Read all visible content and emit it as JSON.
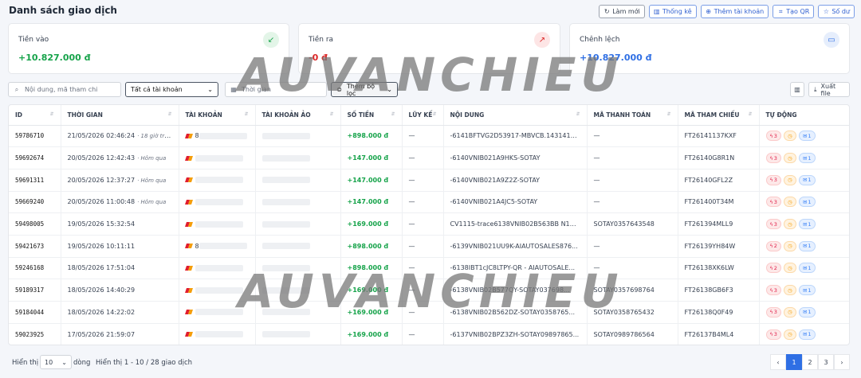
{
  "header": {
    "title": "Danh sách giao dịch",
    "actions": [
      {
        "label": "Làm mới",
        "icon": "refresh-icon",
        "glyph": "↻",
        "blue": false
      },
      {
        "label": "Thống kê",
        "icon": "chart-icon",
        "glyph": "▥",
        "blue": true
      },
      {
        "label": "Thêm tài khoản",
        "icon": "plus-circle-icon",
        "glyph": "⊕",
        "blue": true
      },
      {
        "label": "Tạo QR",
        "icon": "qr-icon",
        "glyph": "⌗",
        "blue": true
      },
      {
        "label": "Số dư",
        "icon": "star-icon",
        "glyph": "☆",
        "blue": true
      }
    ]
  },
  "summary": {
    "in": {
      "label": "Tiền vào",
      "value": "+10.827.000 đ",
      "color": "#16a34a"
    },
    "out": {
      "label": "Tiền ra",
      "value": "-0 đ",
      "color": "#dc2626"
    },
    "diff": {
      "label": "Chênh lệch",
      "value": "+10.827.000 đ",
      "color": "#2f6fe4"
    }
  },
  "filters": {
    "search_placeholder": "Nội dung, mã tham chi",
    "account_select": "Tất cả tài khoản",
    "date_placeholder": "Thời gian",
    "more_filters": "Thêm bộ lọc",
    "export": "Xuất file"
  },
  "table": {
    "columns": [
      "ID",
      "THỜI GIAN",
      "TÀI KHOẢN",
      "TÀI KHOẢN ẢO",
      "SỐ TIỀN",
      "LŨY KẾ",
      "NỘI DUNG",
      "MÃ THANH TOÁN",
      "MÃ THAM CHIẾU",
      "TỰ ĐỘNG"
    ],
    "rows": [
      {
        "id": "59786710",
        "time": "21/05/2026 02:46:24",
        "ago": "· 18 giờ trước",
        "account": "8",
        "amount": "+898.000 đ",
        "cum": "—",
        "content": "-6141BFTVG2D53917-MBVCB.14314113904.f...",
        "paycode": "—",
        "ref": "FT26141137KXF",
        "a": "3",
        "c": "1"
      },
      {
        "id": "59692674",
        "time": "20/05/2026 12:42:43",
        "ago": "· Hôm qua",
        "account": "",
        "amount": "+147.000 đ",
        "cum": "—",
        "content": "-6140VNIB021A9HKS-SOTAY",
        "paycode": "—",
        "ref": "FT26140G8R1N",
        "a": "3",
        "c": "1"
      },
      {
        "id": "59691311",
        "time": "20/05/2026 12:37:27",
        "ago": "· Hôm qua",
        "account": "",
        "amount": "+147.000 đ",
        "cum": "—",
        "content": "-6140VNIB021A9Z2Z-SOTAY",
        "paycode": "—",
        "ref": "FT26140GFL2Z",
        "a": "3",
        "c": "1"
      },
      {
        "id": "59669240",
        "time": "20/05/2026 11:00:48",
        "ago": "· Hôm qua",
        "account": "",
        "amount": "+147.000 đ",
        "cum": "—",
        "content": "-6140VNIB021A4JC5-SOTAY",
        "paycode": "—",
        "ref": "FT261400T34M",
        "a": "3",
        "c": "1"
      },
      {
        "id": "59498005",
        "time": "19/05/2026 15:32:54",
        "ago": "",
        "account": "",
        "amount": "+169.000 đ",
        "cum": "—",
        "content": "CV1115-trace6138VNIB02B563BB N18/...",
        "paycode": "SOTAY0357643548",
        "ref": "FT261394MLL9",
        "a": "3",
        "c": "1"
      },
      {
        "id": "59421673",
        "time": "19/05/2026 10:11:11",
        "ago": "",
        "account": "8",
        "amount": "+898.000 đ",
        "cum": "—",
        "content": "-6139VNIB021UU9K-AIAUTOSALES876...",
        "paycode": "—",
        "ref": "FT26139YH84W",
        "a": "2",
        "c": "1"
      },
      {
        "id": "59246168",
        "time": "18/05/2026 17:51:04",
        "ago": "",
        "account": "",
        "amount": "+898.000 đ",
        "cum": "—",
        "content": "-6138IBT1cJC8LTPY-QR - AIAUTOSALE...",
        "paycode": "—",
        "ref": "FT26138XK6LW",
        "a": "2",
        "c": "1"
      },
      {
        "id": "59189317",
        "time": "18/05/2026 14:40:29",
        "ago": "",
        "account": "",
        "amount": "+169.000 đ",
        "cum": "—",
        "content": "-6138VNIB02B577QY-SOTAY037698...",
        "paycode": "SOTAY0357698764",
        "ref": "FT26138GB6F3",
        "a": "3",
        "c": "1"
      },
      {
        "id": "59184044",
        "time": "18/05/2026 14:22:02",
        "ago": "",
        "account": "",
        "amount": "+169.000 đ",
        "cum": "—",
        "content": "-6138VNIB02B562DZ-SOTAY0358765...",
        "paycode": "SOTAY0358765432",
        "ref": "FT26138Q0F49",
        "a": "3",
        "c": "1"
      },
      {
        "id": "59023925",
        "time": "17/05/2026 21:59:07",
        "ago": "",
        "account": "",
        "amount": "+169.000 đ",
        "cum": "—",
        "content": "-6137VNIB02BPZ3ZH-SOTAY09897865...",
        "paycode": "SOTAY0989786564",
        "ref": "FT26137B4ML4",
        "a": "3",
        "c": "1"
      }
    ]
  },
  "footer": {
    "show_label": "Hiển thị",
    "page_size": "10",
    "rows_label": "dòng",
    "range_text": "Hiển thị 1 - 10 / 28 giao dịch",
    "pages": [
      "‹",
      "1",
      "2",
      "3",
      "›"
    ]
  },
  "watermark": "AUVANCHIEU"
}
